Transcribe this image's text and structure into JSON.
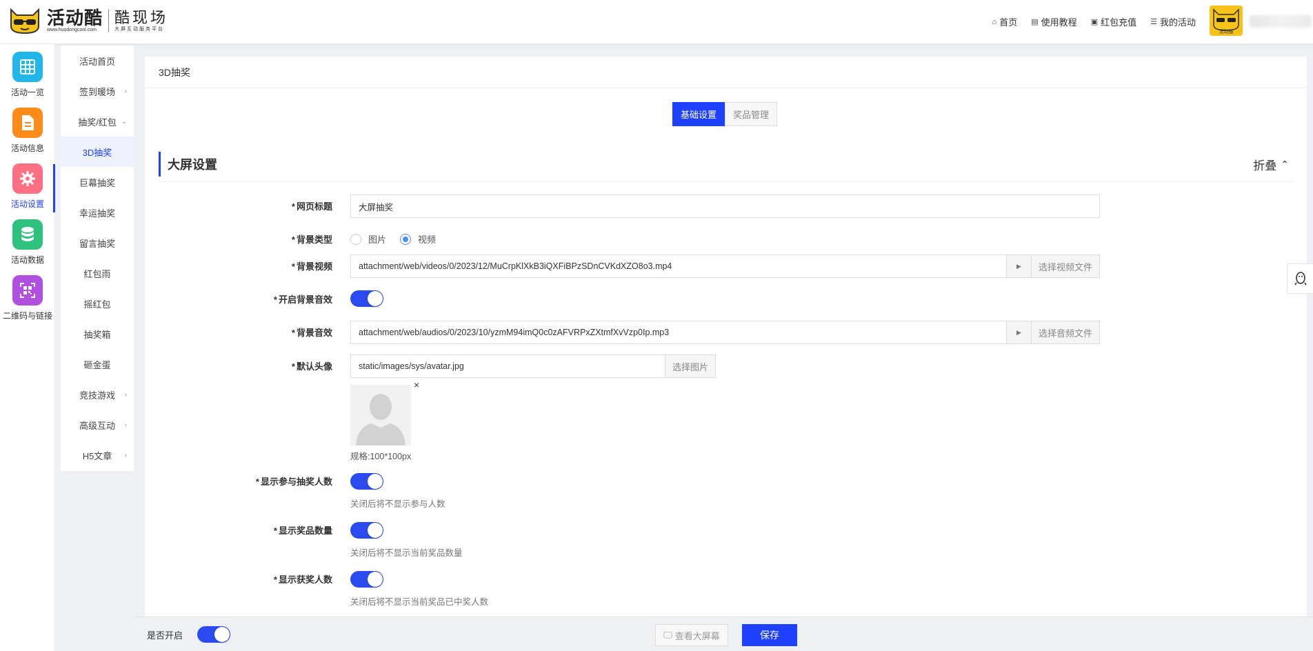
{
  "header": {
    "logo_name": "活动酷",
    "logo_url": "www.huodongcool.com",
    "logo_sub_title": "酷现场",
    "logo_sub_tagline": "大屏互动服务平台",
    "nav": [
      {
        "label": "首页",
        "icon": "home-icon"
      },
      {
        "label": "使用教程",
        "icon": "document-icon"
      },
      {
        "label": "红包充值",
        "icon": "wallet-icon"
      },
      {
        "label": "我的活动",
        "icon": "list-icon"
      }
    ],
    "avatar_label": "活动酷"
  },
  "rail": [
    {
      "label": "活动一览",
      "icon": "grid-icon",
      "color": "#22b7e8"
    },
    {
      "label": "活动信息",
      "icon": "document-icon",
      "color": "#ff8c1a"
    },
    {
      "label": "活动设置",
      "icon": "gear-icon",
      "color": "#ff6f83",
      "active": true
    },
    {
      "label": "活动数据",
      "icon": "database-icon",
      "color": "#2ec27e"
    },
    {
      "label": "二维码与链接",
      "icon": "qrcode-icon",
      "color": "#b04fe0"
    }
  ],
  "submenu": [
    {
      "label": "活动首页",
      "chevron": ""
    },
    {
      "label": "签到暖场",
      "chevron": "›"
    },
    {
      "label": "抽奖/红包",
      "chevron": "⌄"
    },
    {
      "label": "3D抽奖",
      "chevron": "",
      "active": true
    },
    {
      "label": "巨幕抽奖",
      "chevron": ""
    },
    {
      "label": "幸运抽奖",
      "chevron": ""
    },
    {
      "label": "留言抽奖",
      "chevron": ""
    },
    {
      "label": "红包雨",
      "chevron": ""
    },
    {
      "label": "摇红包",
      "chevron": ""
    },
    {
      "label": "抽奖箱",
      "chevron": ""
    },
    {
      "label": "砸金蛋",
      "chevron": ""
    },
    {
      "label": "竞技游戏",
      "chevron": "›"
    },
    {
      "label": "高级互动",
      "chevron": "›"
    },
    {
      "label": "H5文章",
      "chevron": "›"
    }
  ],
  "page": {
    "breadcrumb": "3D抽奖",
    "tabs": [
      {
        "label": "基础设置",
        "active": true
      },
      {
        "label": "奖品管理",
        "active": false
      }
    ],
    "section_title": "大屏设置",
    "collapse_label": "折叠",
    "collapse_icon": "⌃"
  },
  "form": {
    "page_title_label": "网页标题",
    "page_title_value": "大屏抽奖",
    "bg_type_label": "背景类型",
    "bg_type_options": [
      "图片",
      "视频"
    ],
    "bg_type_selected": "视频",
    "bg_video_label": "背景视频",
    "bg_video_value": "attachment/web/videos/0/2023/12/MuCrpKlXkB3iQXFiBPzSDnCVKdXZO8o3.mp4",
    "bg_video_button": "选择视频文件",
    "bg_audio_enable_label": "开启背景音效",
    "bg_audio_enable": true,
    "bg_audio_label": "背景音效",
    "bg_audio_value": "attachment/web/audios/0/2023/10/yzmM94imQ0c0zAFVRPxZXtmfXvVzp0Ip.mp3",
    "bg_audio_button": "选择音频文件",
    "default_avatar_label": "默认头像",
    "default_avatar_value": "static/images/sys/avatar.jpg",
    "default_avatar_button": "选择图片",
    "avatar_close": "×",
    "avatar_spec": "规格:100*100px",
    "show_participants_label": "显示参与抽奖人数",
    "show_participants": true,
    "show_participants_hint": "关闭后将不显示参与人数",
    "show_prize_count_label": "显示奖品数量",
    "show_prize_count": true,
    "show_prize_count_hint": "关闭后将不显示当前奖品数量",
    "show_winners_label": "显示获奖人数",
    "show_winners": true,
    "show_winners_hint": "关闭后将不显示当前奖品已中奖人数"
  },
  "footer": {
    "enabled_label": "是否开启",
    "enabled": true,
    "view_screen_label": "查看大屏幕",
    "save_label": "保存"
  },
  "colors": {
    "primary": "#1e40ff",
    "toggle_on": "#2b4bf0"
  }
}
